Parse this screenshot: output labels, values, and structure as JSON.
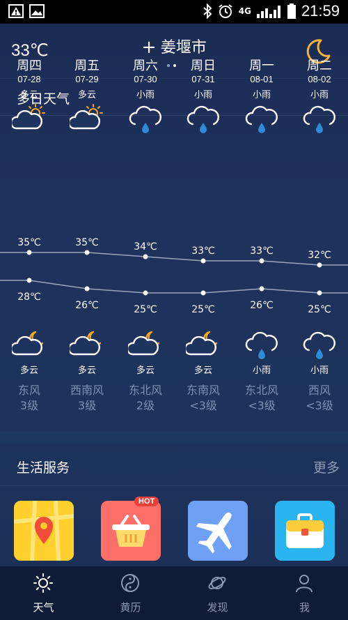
{
  "status_bar": {
    "network": "4G",
    "time": "21:59"
  },
  "header": {
    "current_temp": "33℃",
    "add_symbol": "+",
    "city": "姜堰市"
  },
  "forecast": {
    "title": "多日天气",
    "days": [
      {
        "day": "周四",
        "date": "07-28",
        "day_cond": "多云",
        "high": "35℃",
        "low": "28℃",
        "night_cond": "多云",
        "wind_dir": "东风",
        "wind_level": "3级",
        "day_icon": "partly-cloudy-sun-icon",
        "night_icon": "partly-cloudy-moon-icon"
      },
      {
        "day": "周五",
        "date": "07-29",
        "day_cond": "多云",
        "high": "35℃",
        "low": "26℃",
        "night_cond": "多云",
        "wind_dir": "西南风",
        "wind_level": "3级",
        "day_icon": "partly-cloudy-sun-icon",
        "night_icon": "partly-cloudy-moon-icon"
      },
      {
        "day": "周六",
        "date": "07-30",
        "day_cond": "小雨",
        "high": "34℃",
        "low": "25℃",
        "night_cond": "多云",
        "wind_dir": "东北风",
        "wind_level": "2级",
        "day_icon": "rain-icon",
        "night_icon": "partly-cloudy-moon-icon"
      },
      {
        "day": "周日",
        "date": "07-31",
        "day_cond": "小雨",
        "high": "33℃",
        "low": "25℃",
        "night_cond": "多云",
        "wind_dir": "东南风",
        "wind_level": "<3级",
        "day_icon": "rain-icon",
        "night_icon": "partly-cloudy-moon-icon"
      },
      {
        "day": "周一",
        "date": "08-01",
        "day_cond": "小雨",
        "high": "33℃",
        "low": "26℃",
        "night_cond": "小雨",
        "wind_dir": "东北风",
        "wind_level": "<3级",
        "day_icon": "rain-icon",
        "night_icon": "rain-icon"
      },
      {
        "day": "周二",
        "date": "08-02",
        "day_cond": "小雨",
        "high": "32℃",
        "low": "25℃",
        "night_cond": "小雨",
        "wind_dir": "西风",
        "wind_level": "<3级",
        "day_icon": "rain-icon",
        "night_icon": "rain-icon"
      }
    ]
  },
  "services": {
    "title": "生活服务",
    "more": "更多",
    "hot_badge": "HOT",
    "apps": [
      {
        "icon": "map-pin-app-icon",
        "color": "#ffd02e"
      },
      {
        "icon": "shopping-basket-app-icon",
        "color": "#ff6f6a"
      },
      {
        "icon": "airplane-app-icon",
        "color": "#6ea0f5"
      },
      {
        "icon": "briefcase-app-icon",
        "color": "#2ab4f0"
      }
    ]
  },
  "tabs": [
    {
      "label": "天气",
      "icon": "sun-icon",
      "active": true
    },
    {
      "label": "黄历",
      "icon": "yin-yang-icon",
      "active": false
    },
    {
      "label": "发现",
      "icon": "planet-icon",
      "active": false
    },
    {
      "label": "我",
      "icon": "person-icon",
      "active": false
    }
  ],
  "colors": {
    "accent": "#f6b23a",
    "raindrop": "#2f8ad8",
    "sun": "#f6a623"
  }
}
